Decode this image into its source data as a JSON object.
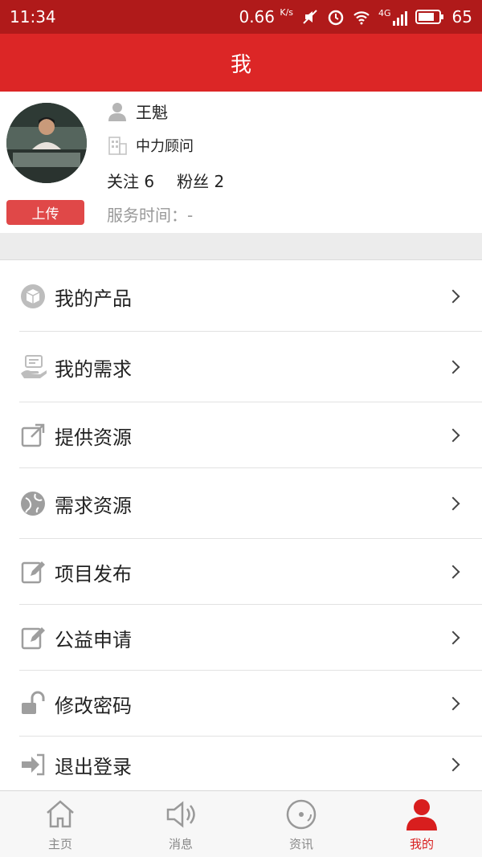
{
  "status_bar": {
    "time": "11:34",
    "speed": "0.66",
    "speed_unit": "K/s",
    "network": "4G",
    "battery": "65"
  },
  "header": {
    "title": "我"
  },
  "profile": {
    "name": "王魁",
    "company": "中力顾问",
    "follow_label": "关注 6",
    "fans_label": "粉丝 2",
    "service_time": "服务时间：-",
    "upload_label": "上传"
  },
  "menu": {
    "items": [
      {
        "label": "我的产品",
        "icon": "box-icon"
      },
      {
        "label": "我的需求",
        "icon": "computer-hand-icon"
      },
      {
        "label": "提供资源",
        "icon": "share-icon"
      },
      {
        "label": "需求资源",
        "icon": "globe-icon"
      },
      {
        "label": "项目发布",
        "icon": "edit-icon"
      },
      {
        "label": "公益申请",
        "icon": "edit-icon"
      },
      {
        "label": "修改密码",
        "icon": "unlock-icon"
      },
      {
        "label": "退出登录",
        "icon": "logout-icon"
      }
    ]
  },
  "tabbar": {
    "tabs": [
      {
        "label": "主页",
        "icon": "home-icon"
      },
      {
        "label": "消息",
        "icon": "speaker-icon"
      },
      {
        "label": "资讯",
        "icon": "disc-icon"
      },
      {
        "label": "我的",
        "icon": "user-icon",
        "active": true
      }
    ]
  },
  "colors": {
    "header": "#dc2626",
    "status_bar": "#b01a1a",
    "upload_button": "#e04848",
    "active_tab": "#d81e1e"
  }
}
